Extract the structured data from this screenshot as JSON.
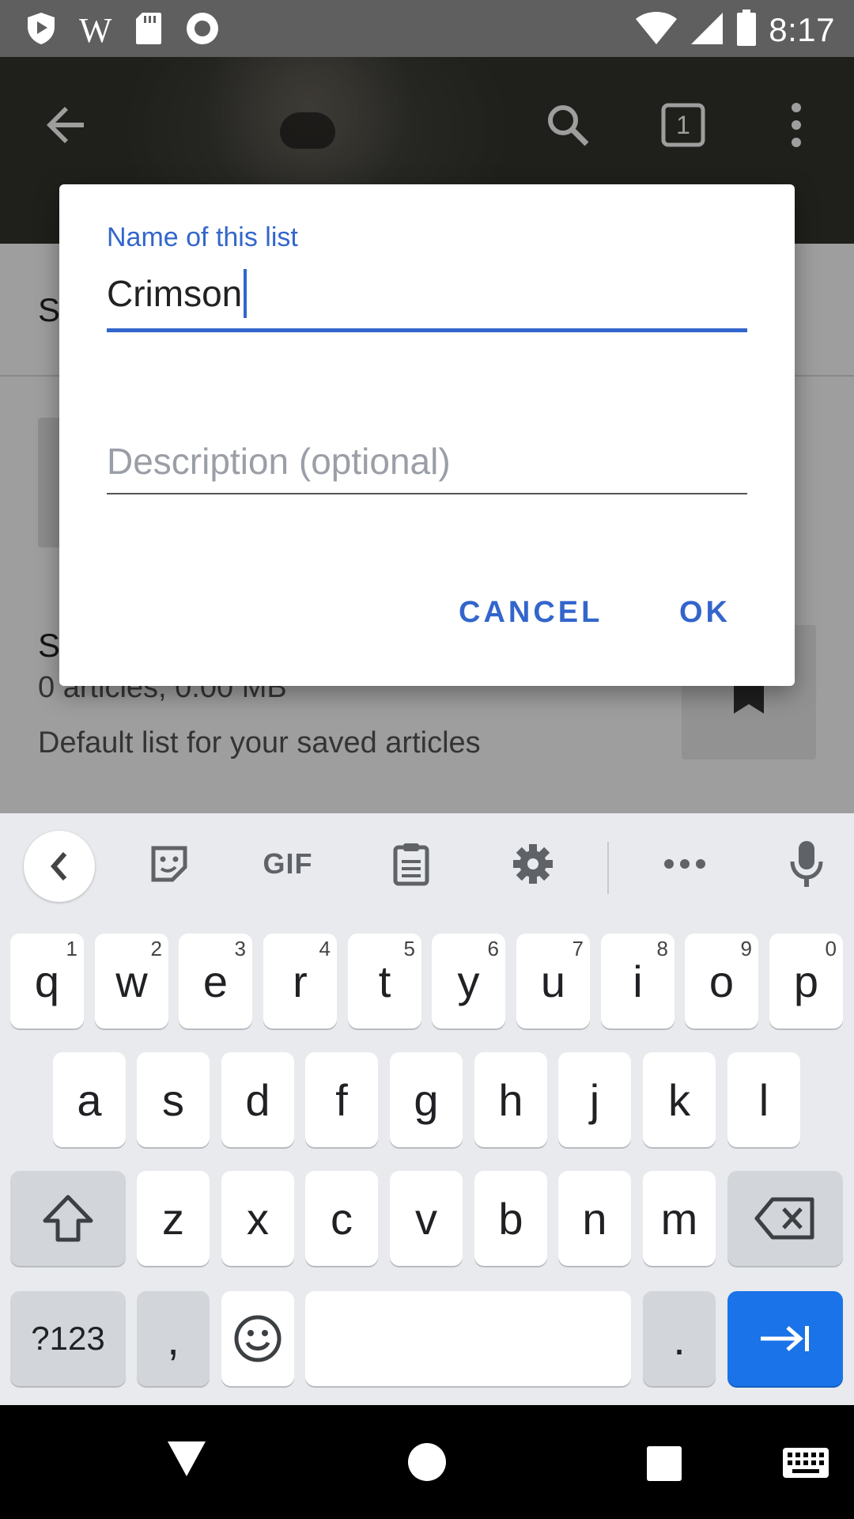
{
  "status_bar": {
    "time": "8:17",
    "left_icons": [
      "shield-icon",
      "wikipedia-icon",
      "sd-card-icon",
      "record-icon"
    ],
    "wiki_glyph": "W",
    "right_icons": [
      "wifi-icon",
      "signal-icon",
      "battery-icon"
    ]
  },
  "toolbar": {
    "tabs_count": "1",
    "icons": [
      "back-arrow-icon",
      "search-icon",
      "tabs-icon",
      "overflow-menu-icon"
    ]
  },
  "background_page": {
    "section_title": "S",
    "list": {
      "title": "S",
      "meta": "0 articles, 0.00 MB",
      "description": "Default list for your saved articles"
    }
  },
  "dialog": {
    "name_label": "Name of this list",
    "name_value": "Crimson",
    "description_placeholder": "Description (optional)",
    "cancel_label": "CANCEL",
    "ok_label": "OK"
  },
  "keyboard": {
    "toolbar": {
      "gif_label": "GIF",
      "icons": [
        "chevron-left-icon",
        "sticker-icon",
        "clipboard-icon",
        "gear-icon",
        "more-icon",
        "mic-icon"
      ]
    },
    "row1": [
      {
        "k": "q",
        "n": "1"
      },
      {
        "k": "w",
        "n": "2"
      },
      {
        "k": "e",
        "n": "3"
      },
      {
        "k": "r",
        "n": "4"
      },
      {
        "k": "t",
        "n": "5"
      },
      {
        "k": "y",
        "n": "6"
      },
      {
        "k": "u",
        "n": "7"
      },
      {
        "k": "i",
        "n": "8"
      },
      {
        "k": "o",
        "n": "9"
      },
      {
        "k": "p",
        "n": "0"
      }
    ],
    "row2": [
      "a",
      "s",
      "d",
      "f",
      "g",
      "h",
      "j",
      "k",
      "l"
    ],
    "row3": [
      "z",
      "x",
      "c",
      "v",
      "b",
      "n",
      "m"
    ],
    "symbols_label": "?123",
    "comma_label": ",",
    "period_label": "."
  },
  "colors": {
    "accent": "#3366cc",
    "enter_key": "#1a73e8",
    "keyboard_bg": "#e8eaed"
  }
}
